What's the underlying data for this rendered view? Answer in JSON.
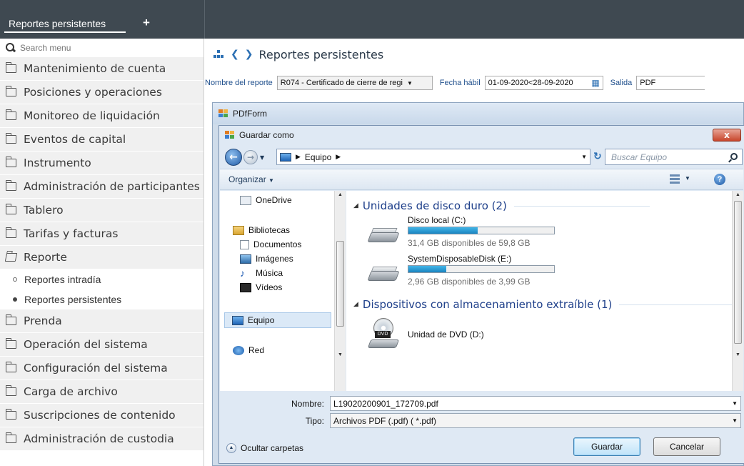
{
  "topbar": {
    "tab_label": "Reportes persistentes",
    "add_tab_glyph": "+"
  },
  "sidebar": {
    "search_placeholder": "Search menu",
    "items": [
      {
        "label": "Mantenimiento de cuenta"
      },
      {
        "label": "Posiciones y operaciones"
      },
      {
        "label": "Monitoreo de liquidación"
      },
      {
        "label": "Eventos de capital"
      },
      {
        "label": "Instrumento"
      },
      {
        "label": "Administración de participantes"
      },
      {
        "label": "Tablero"
      },
      {
        "label": "Tarifas y facturas"
      },
      {
        "label": "Reporte"
      },
      {
        "label": "Prenda"
      },
      {
        "label": "Operación del sistema"
      },
      {
        "label": "Configuración del sistema"
      },
      {
        "label": "Carga de archivo"
      },
      {
        "label": "Suscripciones de contenido"
      },
      {
        "label": "Administración de custodia"
      }
    ],
    "sub_items": [
      {
        "label": "Reportes intradía",
        "selected": false
      },
      {
        "label": "Reportes persistentes",
        "selected": true
      }
    ]
  },
  "main": {
    "breadcrumb": "Reportes persistentes",
    "filters": {
      "report_name_label": "Nombre del reporte",
      "report_name_value": "R074 - Certificado de cierre de regi",
      "date_label": "Fecha hábil",
      "date_value": "01-09-2020<28-09-2020",
      "output_label": "Salida",
      "output_value": "PDF"
    }
  },
  "pdfform": {
    "title": "PDfForm"
  },
  "save_dialog": {
    "title": "Guardar como",
    "close_glyph": "x",
    "address": "Equipo",
    "search_placeholder": "Buscar Equipo",
    "organize_label": "Organizar",
    "help_glyph": "?",
    "nav_items": {
      "onedrive": "OneDrive",
      "libraries": "Bibliotecas",
      "documents": "Documentos",
      "images": "Imágenes",
      "music": "Música",
      "videos": "Vídeos",
      "computer": "Equipo",
      "network": "Red"
    },
    "groups": {
      "hard_drives": "Unidades de disco duro (2)",
      "removable": "Dispositivos con almacenamiento extraíble (1)"
    },
    "drives": [
      {
        "name": "Disco local (C:)",
        "free": "31,4 GB disponibles de 59,8 GB",
        "used_fraction": 0.475
      },
      {
        "name": "SystemDisposableDisk (E:)",
        "free": "2,96 GB disponibles de 3,99 GB",
        "used_fraction": 0.258
      }
    ],
    "dvd": {
      "name": "Unidad de DVD (D:)",
      "icon_text": "DVD"
    },
    "filename_label": "Nombre:",
    "filename_value": "L19020200901_172709.pdf",
    "type_label": "Tipo:",
    "type_value": "Archivos PDF (.pdf)  ( *.pdf)",
    "hide_folders": "Ocultar carpetas",
    "save_button": "Guardar",
    "cancel_button": "Cancelar"
  },
  "colors": {
    "topbar": "#3f4951",
    "accent_blue": "#2b6fb3",
    "progress_fill": "#1b84c0"
  }
}
